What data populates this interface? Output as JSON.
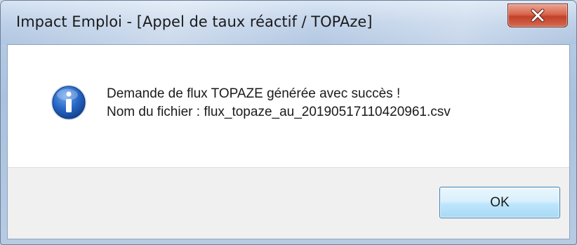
{
  "window": {
    "title": "Impact Emploi - [Appel de taux réactif / TOPAze]",
    "close_icon": "close-icon"
  },
  "message": {
    "icon": "info-icon",
    "line1": "Demande de flux TOPAZE générée avec succès !",
    "line2": "Nom du fichier : flux_topaze_au_20190517110420961.csv"
  },
  "buttons": {
    "ok_label": "OK"
  },
  "colors": {
    "titlebar": "#bdd0e8",
    "close_button": "#c2412a",
    "info_icon": "#1f5fb8",
    "button_area": "#f0f0f0",
    "ok_border": "#3c7fb1"
  }
}
